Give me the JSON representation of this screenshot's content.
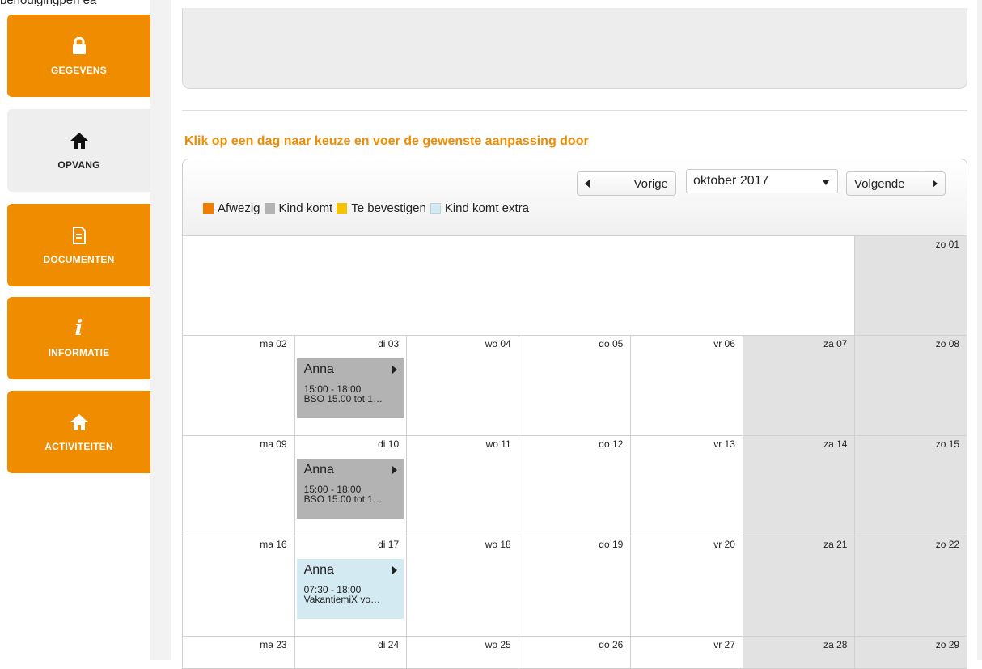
{
  "top_text": "benodigingpen ea",
  "sidebar": {
    "items": [
      {
        "label": "GEGEVENS",
        "icon": "lock-icon"
      },
      {
        "label": "OPVANG",
        "icon": "home-icon"
      },
      {
        "label": "DOCUMENTEN",
        "icon": "document-icon"
      },
      {
        "label": "INFORMATIE",
        "icon": "info-icon"
      },
      {
        "label": "ACTIVITEITEN",
        "icon": "house-icon"
      }
    ],
    "active_index": 1
  },
  "calendar": {
    "title": "Klik op een dag naar keuze en voer de gewenste aanpassing door",
    "prev_label": "Vorige",
    "next_label": "Volgende",
    "month_value": "oktober 2017",
    "legend": [
      {
        "label": "Afwezig",
        "color": "#f07d00"
      },
      {
        "label": "Kind komt",
        "color": "#b3b3b3"
      },
      {
        "label": "Te bevestigen",
        "color": "#f5c400"
      },
      {
        "label": "Kind komt extra",
        "color": "#d4eaf3"
      }
    ],
    "weeks": [
      {
        "days": [
          "",
          "",
          "",
          "",
          "",
          "",
          "zo 01"
        ]
      },
      {
        "days": [
          "ma 02",
          "di 03",
          "wo 04",
          "do 05",
          "vr 06",
          "za 07",
          "zo 08"
        ]
      },
      {
        "days": [
          "ma 09",
          "di 10",
          "wo 11",
          "do 12",
          "vr 13",
          "za 14",
          "zo 15"
        ]
      },
      {
        "days": [
          "ma 16",
          "di 17",
          "wo 18",
          "do 19",
          "vr 20",
          "za 21",
          "zo 22"
        ]
      },
      {
        "days": [
          "ma 23",
          "di 24",
          "wo 25",
          "do 26",
          "vr 27",
          "za 28",
          "zo 29"
        ]
      }
    ],
    "events": [
      {
        "week": 1,
        "day": 1,
        "name": "Anna",
        "time": "15:00 - 18:00",
        "desc": "BSO 15.00 tot 1…",
        "type": "komt"
      },
      {
        "week": 2,
        "day": 1,
        "name": "Anna",
        "time": "15:00 - 18:00",
        "desc": "BSO 15.00 tot 1…",
        "type": "komt"
      },
      {
        "week": 3,
        "day": 1,
        "name": "Anna",
        "time": "07:30 - 18:00",
        "desc": "VakantiemiX vo…",
        "type": "extra"
      }
    ]
  }
}
